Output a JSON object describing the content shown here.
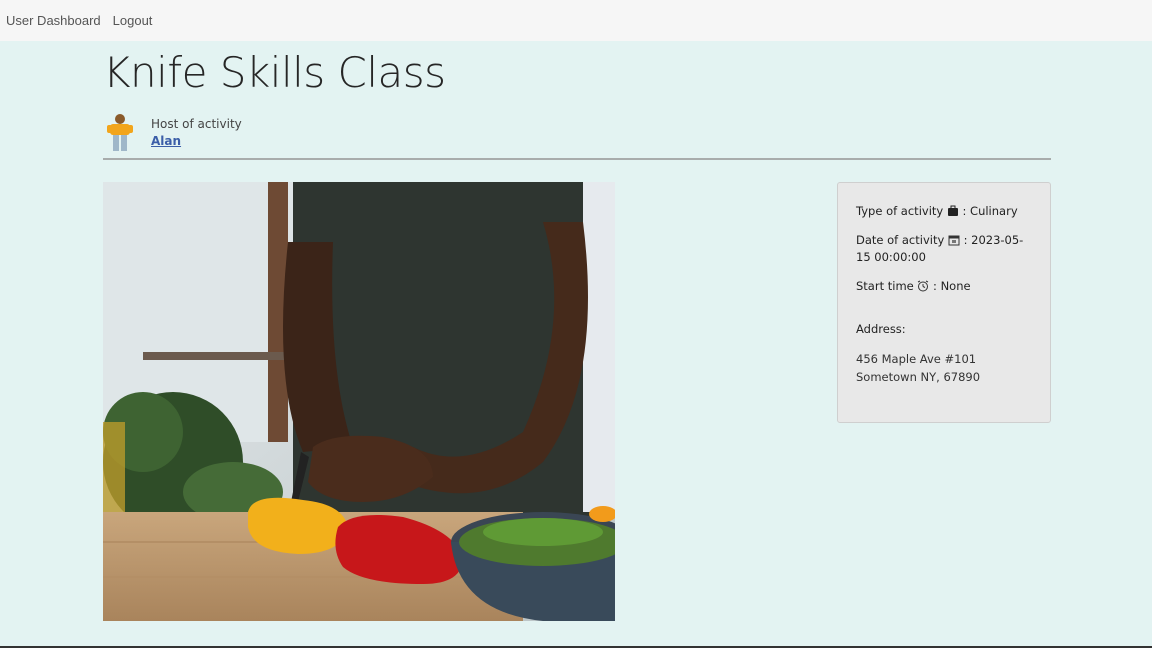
{
  "nav": {
    "dashboard": "User Dashboard",
    "logout": "Logout"
  },
  "activity": {
    "title": "Knife Skills Class",
    "host_label": "Host of activity",
    "host_name": "Alan"
  },
  "details": {
    "type_label": "Type of activity",
    "type_value": ": Culinary",
    "date_label": "Date of activity",
    "date_value": ": 2023-05-15 00:00:00",
    "start_label": "Start time",
    "start_value": ": None",
    "address_label": "Address:",
    "address_line1": "456 Maple Ave #101",
    "address_line2": "Sometown NY, 67890"
  },
  "colors": {
    "background": "#e3f3f2",
    "link": "#3b5ea8",
    "card": "#e8e8e8"
  },
  "icons": {
    "type": "briefcase-icon",
    "date": "calendar-icon",
    "time": "alarm-clock-icon",
    "avatar": "person-avatar"
  }
}
